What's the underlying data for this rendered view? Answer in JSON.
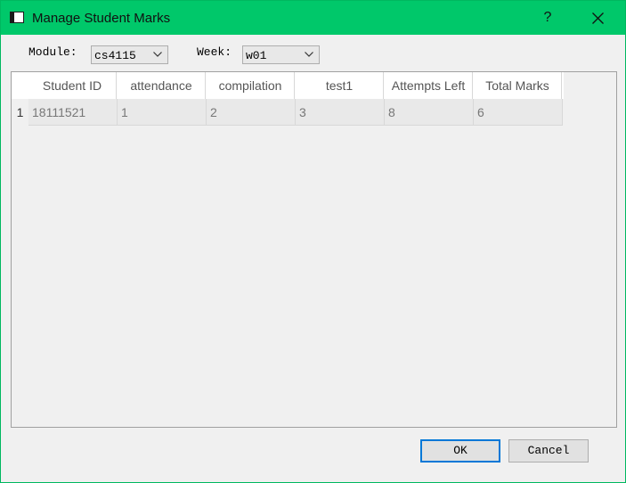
{
  "window": {
    "title": "Manage Student Marks",
    "help_glyph": "?",
    "accent_color": "#00c86a"
  },
  "filters": {
    "module_label": "Module:",
    "module_value": "cs4115",
    "week_label": "Week:",
    "week_value": "w01"
  },
  "table": {
    "columns": [
      "Student ID",
      "attendance",
      "compilation",
      "test1",
      "Attempts Left",
      "Total Marks"
    ],
    "rows": [
      {
        "row_number": "1",
        "cells": [
          "18111521",
          "1",
          "2",
          "3",
          "8",
          "6"
        ]
      }
    ]
  },
  "buttons": {
    "ok_label": "OK",
    "cancel_label": "Cancel"
  },
  "icons": {
    "app": "window-icon",
    "close": "close-icon",
    "dropdown": "chevron-down-icon"
  }
}
